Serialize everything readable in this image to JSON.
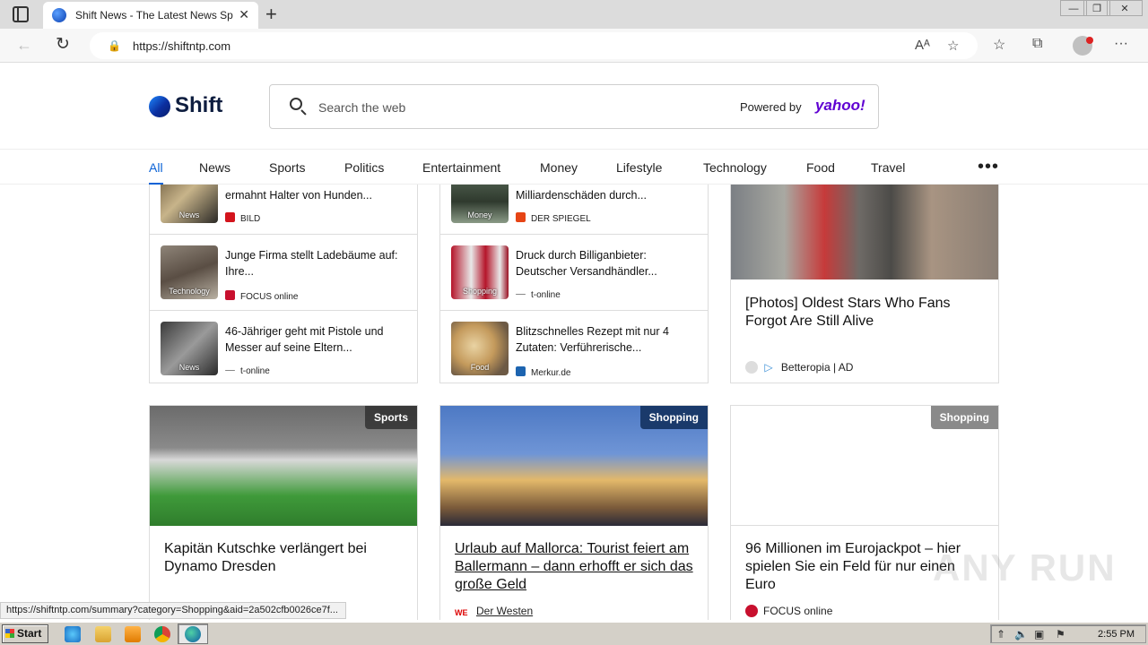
{
  "browser": {
    "tab_title": "Shift News - The Latest News Spo",
    "url": "https://shiftntp.com",
    "status_url": "https://shiftntp.com/summary?category=Shopping&aid=2a502cfb0026ce7f..."
  },
  "site": {
    "logo_text": "Shift",
    "search_placeholder": "Search the web",
    "powered_by": "Powered by",
    "powered_brand": "yahoo!"
  },
  "nav": {
    "items": [
      "All",
      "News",
      "Sports",
      "Politics",
      "Entertainment",
      "Money",
      "Lifestyle",
      "Technology",
      "Food",
      "Travel"
    ],
    "more": "•••"
  },
  "col1": [
    {
      "title": "ermahnt Halter von Hunden...",
      "tag": "News",
      "source": "BILD"
    },
    {
      "title": "Junge Firma stellt Ladebäume auf: Ihre...",
      "tag": "Technology",
      "source": "FOCUS online"
    },
    {
      "title": "46-Jähriger geht mit Pistole und Messer auf seine Eltern...",
      "tag": "News",
      "source": "t-online"
    }
  ],
  "col2": [
    {
      "title": "Milliardenschäden durch...",
      "tag": "Money",
      "source": "DER SPIEGEL"
    },
    {
      "title": "Druck durch Billiganbieter: Deutscher Versandhändler...",
      "tag": "Shopping",
      "source": "t-online"
    },
    {
      "title": "Blitzschnelles Rezept mit nur 4 Zutaten: Verführerische...",
      "tag": "Food",
      "source": "Merkur.de"
    }
  ],
  "ad": {
    "title": "[Photos] Oldest Stars Who Fans Forgot Are Still Alive",
    "source": "Betteropia | AD"
  },
  "big_cards": [
    {
      "badge": "Sports",
      "title": "Kapitän Kutschke verlängert bei Dynamo Dresden",
      "source": ""
    },
    {
      "badge": "Shopping",
      "title": "Urlaub auf Mallorca: Tourist feiert am Ballermann – dann erhofft er sich das große Geld",
      "source": "Der Westen"
    },
    {
      "badge": "Shopping",
      "title": "96 Millionen im Eurojackpot – hier spielen Sie ein Feld für nur einen Euro",
      "source": "FOCUS online"
    }
  ],
  "watermark": "ANY RUN",
  "taskbar": {
    "start_label": "Start",
    "clock": "2:55 PM"
  }
}
